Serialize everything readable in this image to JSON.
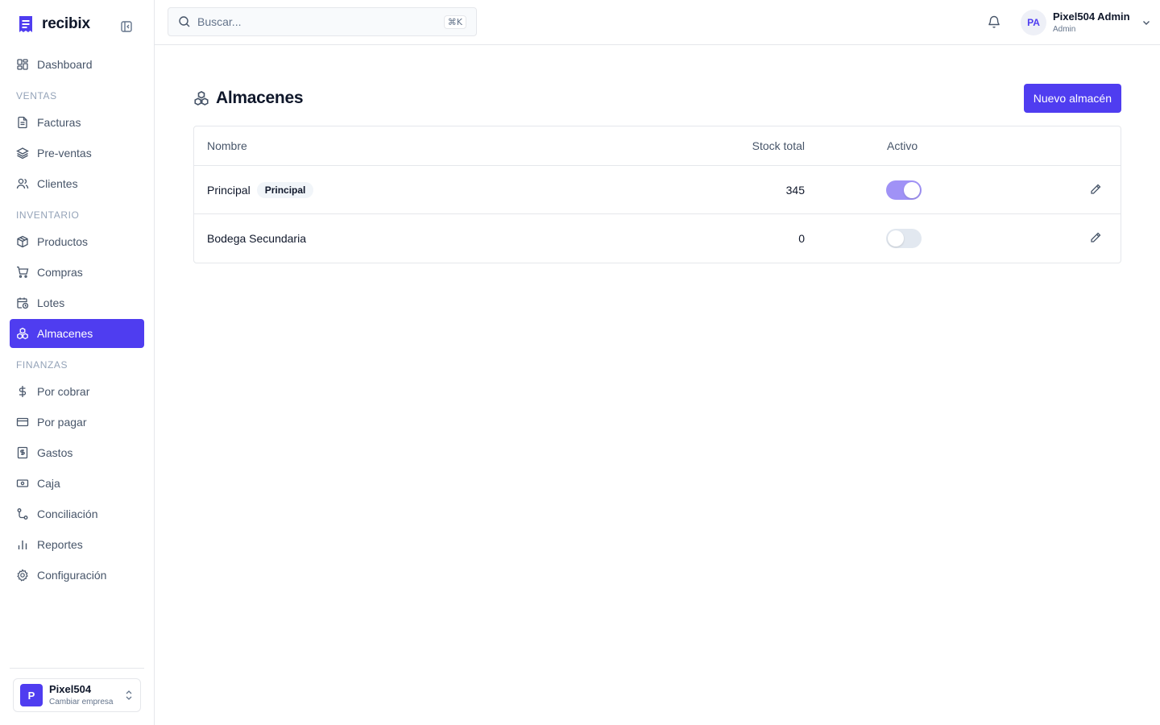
{
  "brand": {
    "name": "recibix",
    "color": "#4f3df0"
  },
  "sidebar": {
    "items": [
      {
        "label": "Dashboard",
        "icon": "dashboard-icon"
      },
      {
        "section": "VENTAS"
      },
      {
        "label": "Facturas",
        "icon": "file-text-icon"
      },
      {
        "label": "Pre-ventas",
        "icon": "layers-icon"
      },
      {
        "label": "Clientes",
        "icon": "users-icon"
      },
      {
        "section": "INVENTARIO"
      },
      {
        "label": "Productos",
        "icon": "package-icon"
      },
      {
        "label": "Compras",
        "icon": "shopping-cart-icon"
      },
      {
        "label": "Lotes",
        "icon": "calendar-clock-icon"
      },
      {
        "label": "Almacenes",
        "icon": "boxes-icon",
        "active": true
      },
      {
        "section": "FINANZAS"
      },
      {
        "label": "Por cobrar",
        "icon": "dollar-sign-icon"
      },
      {
        "label": "Por pagar",
        "icon": "credit-card-icon"
      },
      {
        "label": "Gastos",
        "icon": "receipt-icon"
      },
      {
        "label": "Caja",
        "icon": "banknote-icon"
      },
      {
        "label": "Conciliación",
        "icon": "git-compare-icon"
      },
      {
        "label": "Reportes",
        "icon": "bar-chart-icon"
      },
      {
        "label": "Configuración",
        "icon": "settings-icon"
      }
    ],
    "company": {
      "initial": "P",
      "name": "Pixel504",
      "subtitle": "Cambiar empresa"
    }
  },
  "header": {
    "search_placeholder": "Buscar...",
    "shortcut": "⌘K",
    "user": {
      "initials": "PA",
      "name": "Pixel504 Admin",
      "role": "Admin"
    }
  },
  "main": {
    "title": "Almacenes",
    "new_button": "Nuevo almacén",
    "columns": {
      "name": "Nombre",
      "stock": "Stock total",
      "active": "Activo"
    },
    "rows": [
      {
        "name": "Principal",
        "badge": "Principal",
        "stock": "345",
        "active": true
      },
      {
        "name": "Bodega Secundaria",
        "badge": "",
        "stock": "0",
        "active": false
      }
    ]
  }
}
